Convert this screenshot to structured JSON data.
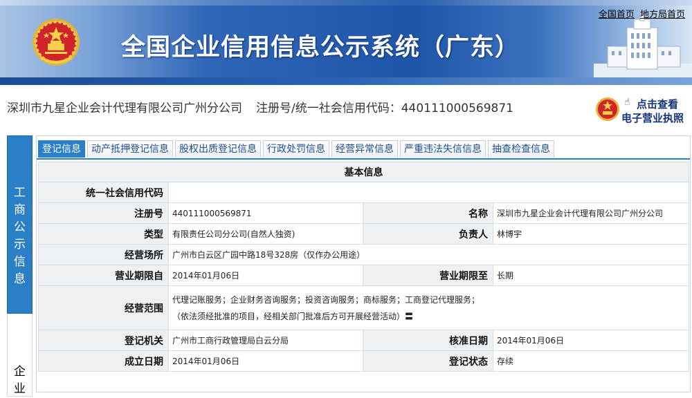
{
  "header": {
    "title": "全国企业信用信息公示系统（广东）",
    "links": [
      {
        "label": "全国首页"
      },
      {
        "label": "地方局首页"
      }
    ],
    "emblem_icon": "national-emblem-icon",
    "colors": {
      "banner": "#1f55a8",
      "accent": "#2a7fc6"
    }
  },
  "company": {
    "name": "深圳市九星企业会计代理有限公司广州分公司",
    "reg_label": "注册号/统一社会信用代码：",
    "reg_value": "440111000569871"
  },
  "license_button": {
    "line1": "点击查看",
    "line2": "电子营业执照",
    "icon": "hand-pointer-icon"
  },
  "side_nav": [
    {
      "label": "工商公示信息",
      "active": true
    },
    {
      "label": "企业",
      "active": false
    }
  ],
  "tabs": [
    {
      "label": "登记信息",
      "active": true
    },
    {
      "label": "动产抵押登记信息"
    },
    {
      "label": "股权出质登记信息"
    },
    {
      "label": "行政处罚信息"
    },
    {
      "label": "经营异常信息"
    },
    {
      "label": "严重违法失信信息"
    },
    {
      "label": "抽查检查信息"
    }
  ],
  "basic_info": {
    "section_title": "基本信息",
    "credit_code_label": "统一社会信用代码",
    "credit_code_value": "",
    "reg_no_label": "注册号",
    "reg_no_value": "440111000569871",
    "name_label": "名称",
    "name_value": "深圳市九星企业会计代理有限公司广州分公司",
    "type_label": "类型",
    "type_value": "有限责任公司分公司(自然人独资)",
    "person_label": "负责人",
    "person_value": "林博宇",
    "address_label": "经营场所",
    "address_value": "广州市白云区广园中路18号328房（仅作办公用途）",
    "term_from_label": "营业期限自",
    "term_from_value": "2014年01月06日",
    "term_to_label": "营业期限至",
    "term_to_value": "长期",
    "scope_label": "经营范围",
    "scope_line1": "代理记账服务；企业财务咨询服务；投资咨询服务；商标服务；工商登记代理服务；",
    "scope_line2": "（依法须经批准的项目，经相关部门批准后方可开展经营活动）〓",
    "authority_label": "登记机关",
    "authority_value": "广州市工商行政管理局白云分局",
    "approve_label": "核准日期",
    "approve_value": "2014年01月06日",
    "founded_label": "成立日期",
    "founded_value": "2014年01月06日",
    "status_label": "登记状态",
    "status_value": "存续"
  }
}
